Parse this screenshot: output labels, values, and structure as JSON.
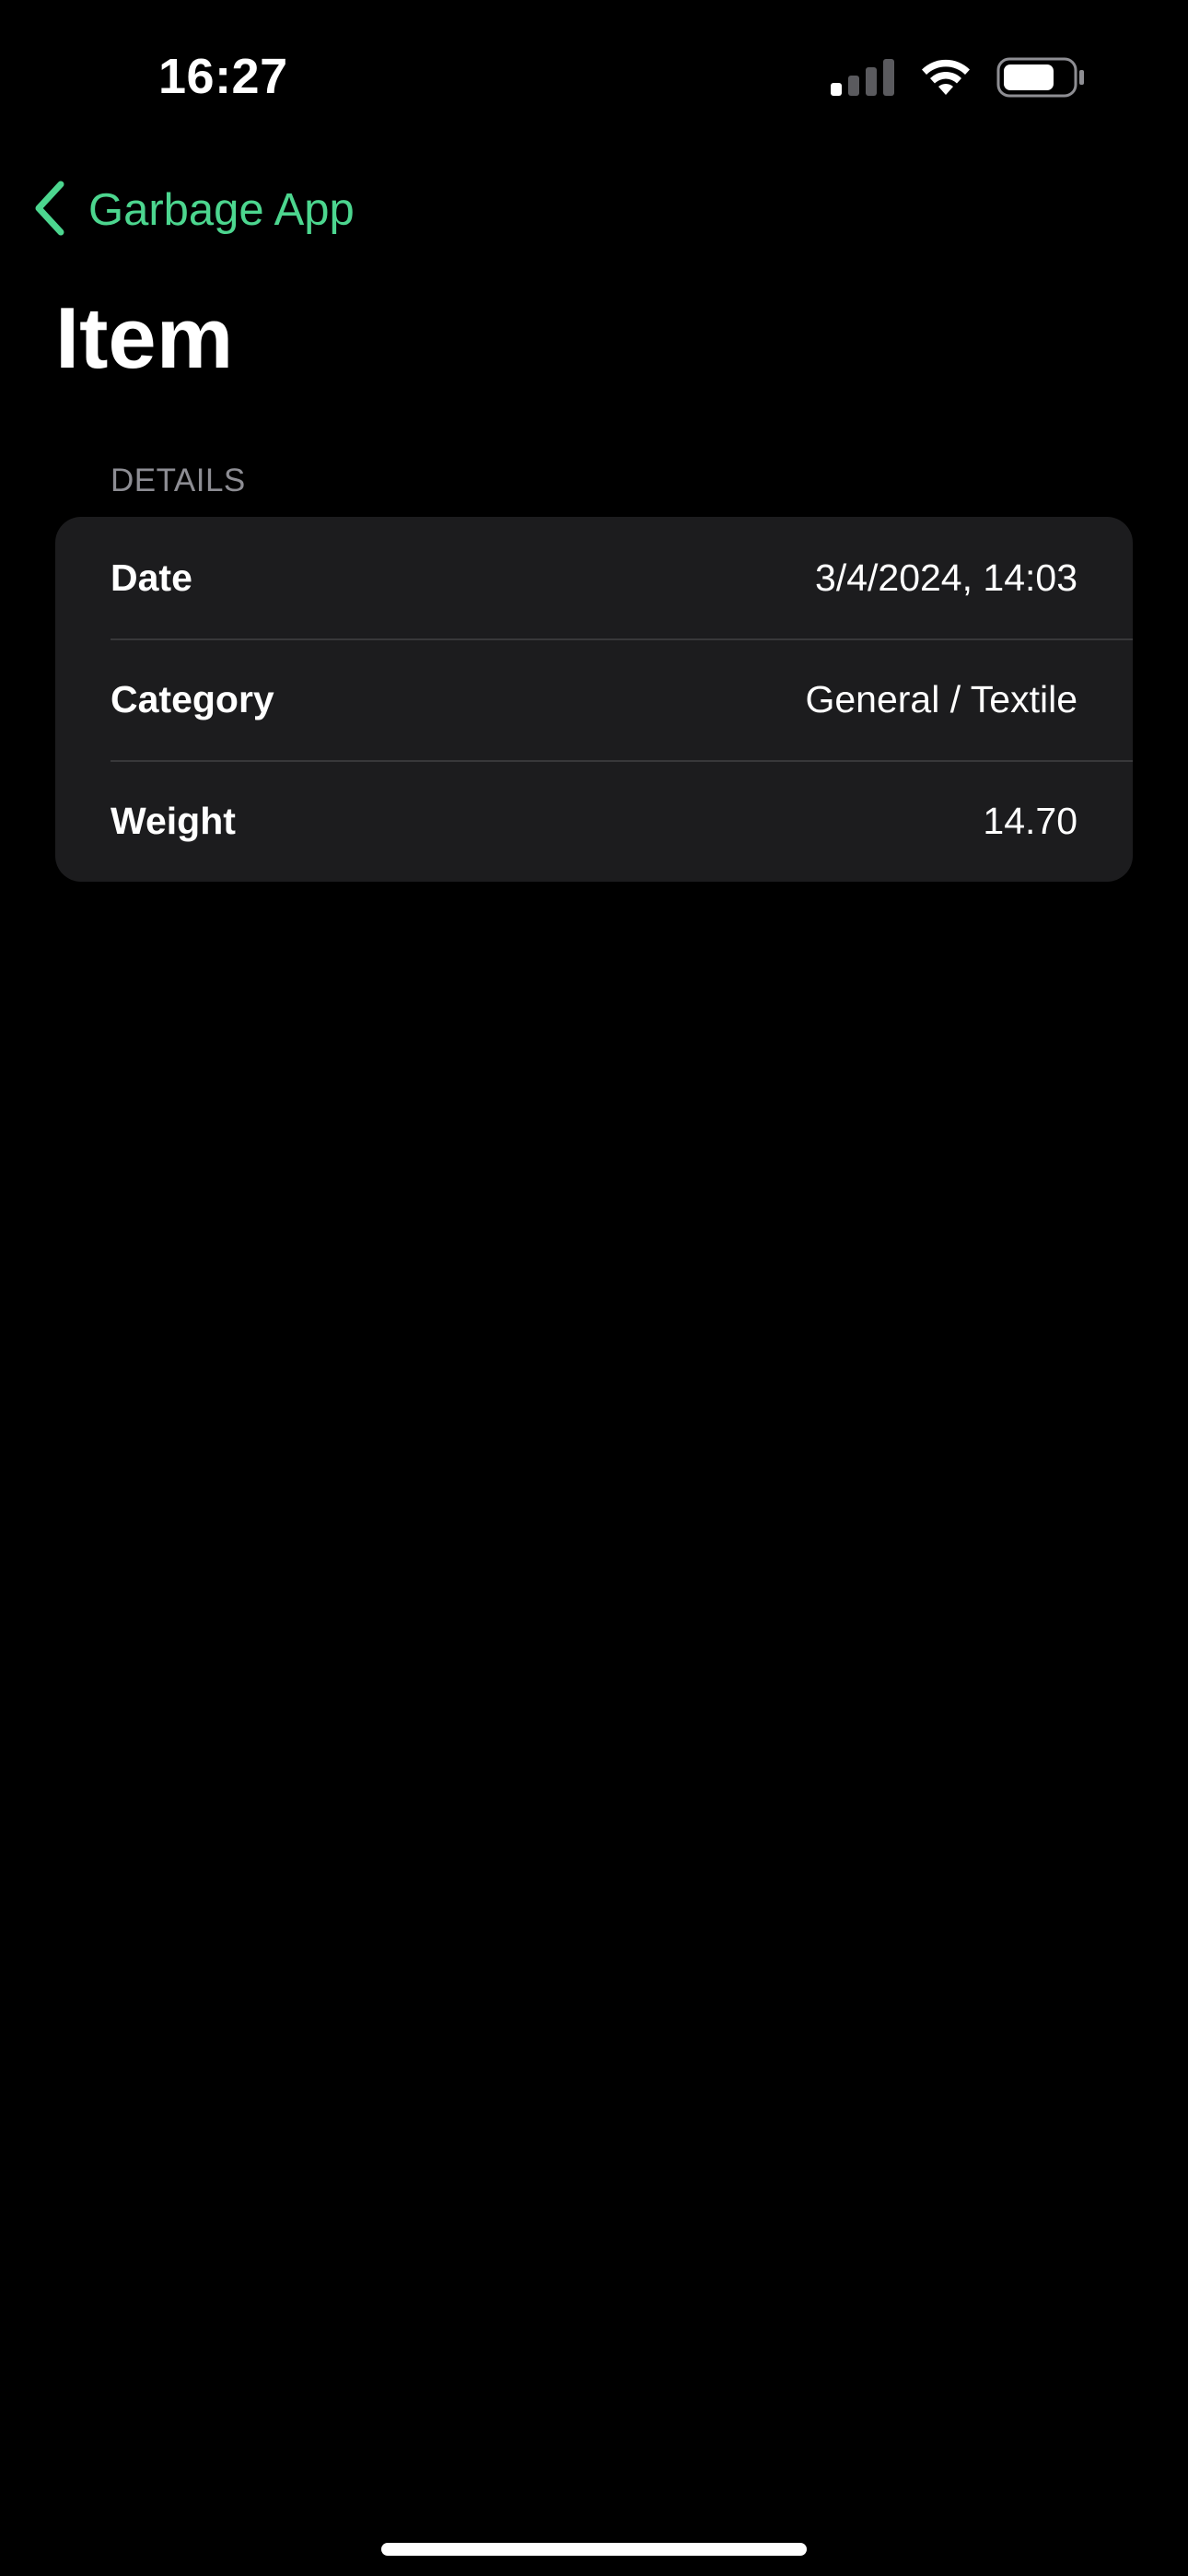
{
  "status_bar": {
    "time": "16:27",
    "signal_icon": "cellular-signal-icon",
    "wifi_icon": "wifi-icon",
    "battery_icon": "battery-icon"
  },
  "navigation": {
    "back_icon": "chevron-left-icon",
    "back_label": "Garbage App",
    "accent_color": "#4cd68f"
  },
  "page": {
    "title": "Item"
  },
  "details": {
    "header": "DETAILS",
    "rows": [
      {
        "label": "Date",
        "value": "3/4/2024, 14:03"
      },
      {
        "label": "Category",
        "value": "General / Textile"
      },
      {
        "label": "Weight",
        "value": "14.70"
      }
    ]
  },
  "colors": {
    "background": "#000000",
    "card": "#1c1c1e",
    "separator": "#38383a",
    "secondary_text": "#8d8d93"
  }
}
